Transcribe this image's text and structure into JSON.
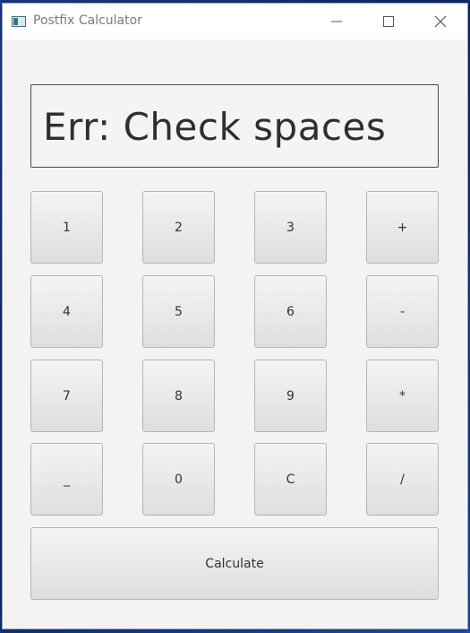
{
  "window": {
    "title": "Postfix Calculator"
  },
  "display": {
    "text": "Err: Check spaces"
  },
  "keys": {
    "k1": "1",
    "k2": "2",
    "k3": "3",
    "plus": "+",
    "k4": "4",
    "k5": "5",
    "k6": "6",
    "minus": "-",
    "k7": "7",
    "k8": "8",
    "k9": "9",
    "multiply": "*",
    "space": "_",
    "k0": "0",
    "clear": "C",
    "divide": "/"
  },
  "calculate_label": "Calculate"
}
